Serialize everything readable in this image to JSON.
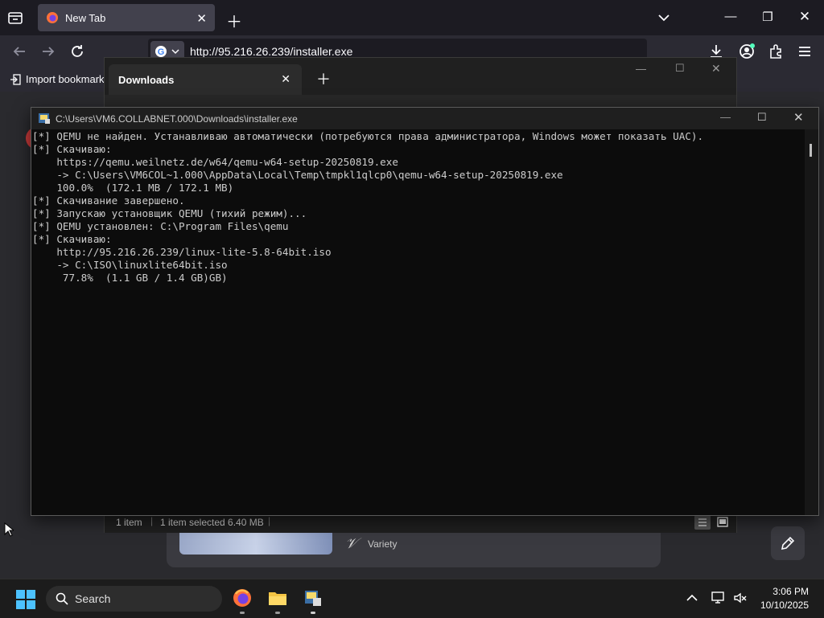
{
  "browser": {
    "tab_title": "New Tab",
    "url": "http://95.216.26.239/installer.exe",
    "bookmark_label": "Import bookmarks...",
    "accent": "#0060df"
  },
  "downloads_window": {
    "tab_label": "Downloads",
    "status": {
      "item_count": "1 item",
      "selected": "1 item selected  6.40 MB"
    }
  },
  "console": {
    "title": "C:\\Users\\VM6.COLLABNET.000\\Downloads\\installer.exe",
    "lines": [
      "[*] QEMU не найден. Устанавливаю автоматически (потребуются права администратора, Windows может показать UAC).",
      "[*] Скачиваю:",
      "    https://qemu.weilnetz.de/w64/qemu-w64-setup-20250819.exe",
      "    -> C:\\Users\\VM6COL~1.000\\AppData\\Local\\Temp\\tmpkl1qlcp0\\qemu-w64-setup-20250819.exe",
      "    100.0%  (172.1 MB / 172.1 MB)",
      "[*] Скачивание завершено.",
      "[*] Запускаю установщик QEMU (тихий режим)...",
      "[*] QEMU установлен: C:\\Program Files\\qemu",
      "[*] Скачиваю:",
      "    http://95.216.26.239/linux-lite-5.8-64bit.iso",
      "    -> C:\\ISO\\linuxlite64bit.iso",
      "     77.8%  (1.1 GB / 1.4 GB)GB)"
    ]
  },
  "background": {
    "variety_label": "Variety"
  },
  "taskbar": {
    "search_label": "Search",
    "time": "3:06 PM",
    "date": "10/10/2025"
  }
}
